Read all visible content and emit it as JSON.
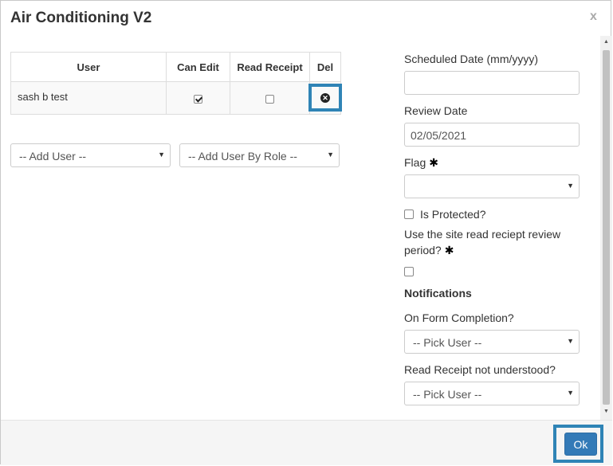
{
  "header": {
    "title": "Air Conditioning V2",
    "close_label": "x"
  },
  "users_table": {
    "columns": [
      "User",
      "Can Edit",
      "Read Receipt",
      "Del"
    ],
    "rows": [
      {
        "user": "sash b test",
        "can_edit": true,
        "read_receipt": false
      }
    ]
  },
  "add_user": {
    "selected": "-- Add User --"
  },
  "add_user_by_role": {
    "selected": "-- Add User By Role --"
  },
  "settings": {
    "scheduled_date_label": "Scheduled Date (mm/yyyy)",
    "scheduled_date_value": "",
    "review_date_label": "Review Date",
    "review_date_value": "02/05/2021",
    "flag_label": "Flag",
    "flag_value": "",
    "is_protected_label": "Is Protected?",
    "is_protected": false,
    "site_read_receipt_label_line1": "Use the site read reciept review",
    "site_read_receipt_label_line2": "period?",
    "site_read_receipt": false,
    "required_marker": "✱"
  },
  "notifications": {
    "heading": "Notifications",
    "on_form_completion_label": "On Form Completion?",
    "on_form_completion_value": "-- Pick User --",
    "read_receipt_not_understood_label": "Read Receipt not understood?",
    "read_receipt_not_understood_value": "-- Pick User --"
  },
  "footer": {
    "ok_label": "Ok"
  },
  "colors": {
    "primary": "#337ab7",
    "highlight": "#2f84b6"
  }
}
